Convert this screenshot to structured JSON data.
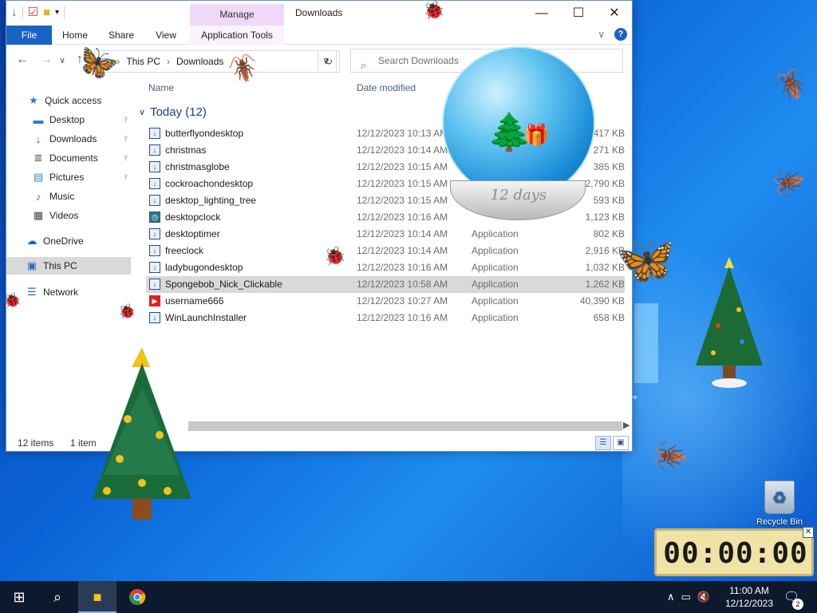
{
  "window": {
    "title": "Downloads",
    "contextual_tab": "Manage",
    "tabs": {
      "file": "File",
      "home": "Home",
      "share": "Share",
      "view": "View",
      "app_tools": "Application Tools"
    }
  },
  "address": {
    "crumbs": [
      "This PC",
      "Downloads"
    ],
    "search_placeholder": "Search Downloads"
  },
  "sidebar": {
    "items": [
      {
        "label": "Quick access",
        "icon": "star-icon"
      },
      {
        "label": "Desktop",
        "icon": "desktop-folder-icon"
      },
      {
        "label": "Downloads",
        "icon": "download-arrow-icon"
      },
      {
        "label": "Documents",
        "icon": "documents-icon"
      },
      {
        "label": "Pictures",
        "icon": "pictures-icon"
      },
      {
        "label": "Music",
        "icon": "music-note-icon"
      },
      {
        "label": "Videos",
        "icon": "videos-icon"
      },
      {
        "label": "OneDrive",
        "icon": "cloud-icon"
      },
      {
        "label": "This PC",
        "icon": "computer-icon"
      },
      {
        "label": "Network",
        "icon": "network-icon"
      }
    ]
  },
  "columns": {
    "name": "Name",
    "date": "Date modified"
  },
  "group": {
    "label": "Today (12)"
  },
  "files": [
    {
      "name": "butterflyondesktop",
      "date": "12/12/2023 10:13 AM",
      "type": "",
      "size": "417 KB",
      "icon": "app-installer-icon"
    },
    {
      "name": "christmas",
      "date": "12/12/2023 10:14 AM",
      "type": "",
      "size": "271 KB",
      "icon": "app-installer-icon"
    },
    {
      "name": "christmasglobe",
      "date": "12/12/2023 10:15 AM",
      "type": "",
      "size": "385 KB",
      "icon": "app-installer-icon"
    },
    {
      "name": "cockroachondesktop",
      "date": "12/12/2023 10:15 AM",
      "type": "",
      "size": "2,790 KB",
      "icon": "app-installer-icon"
    },
    {
      "name": "desktop_lighting_tree",
      "date": "12/12/2023 10:15 AM",
      "type": "",
      "size": "593 KB",
      "icon": "app-installer-icon"
    },
    {
      "name": "desktopclock",
      "date": "12/12/2023 10:16 AM",
      "type": "",
      "size": "1,123 KB",
      "icon": "clock-app-icon"
    },
    {
      "name": "desktoptimer",
      "date": "12/12/2023 10:14 AM",
      "type": "Application",
      "size": "802 KB",
      "icon": "app-installer-icon"
    },
    {
      "name": "freeclock",
      "date": "12/12/2023 10:14 AM",
      "type": "Application",
      "size": "2,916 KB",
      "icon": "app-installer-icon"
    },
    {
      "name": "ladybugondesktop",
      "date": "12/12/2023 10:16 AM",
      "type": "Application",
      "size": "1,032 KB",
      "icon": "app-installer-icon"
    },
    {
      "name": "Spongebob_Nick_Clickable",
      "date": "12/12/2023 10:58 AM",
      "type": "Application",
      "size": "1,262 KB",
      "icon": "app-installer-icon",
      "selected": true
    },
    {
      "name": "username666",
      "date": "12/12/2023 10:27 AM",
      "type": "Application",
      "size": "40,390 KB",
      "icon": "youtube-icon"
    },
    {
      "name": "WinLaunchInstaller",
      "date": "12/12/2023 10:16 AM",
      "type": "Application",
      "size": "658 KB",
      "icon": "app-installer-icon"
    }
  ],
  "status": {
    "count": "12 items",
    "selected": "1 item"
  },
  "desktop": {
    "globe_label": "12 days",
    "recycle_bin": "Recycle Bin",
    "timer": "00:00:00"
  },
  "taskbar": {
    "time": "11:00 AM",
    "date": "12/12/2023",
    "notifications": "2"
  }
}
